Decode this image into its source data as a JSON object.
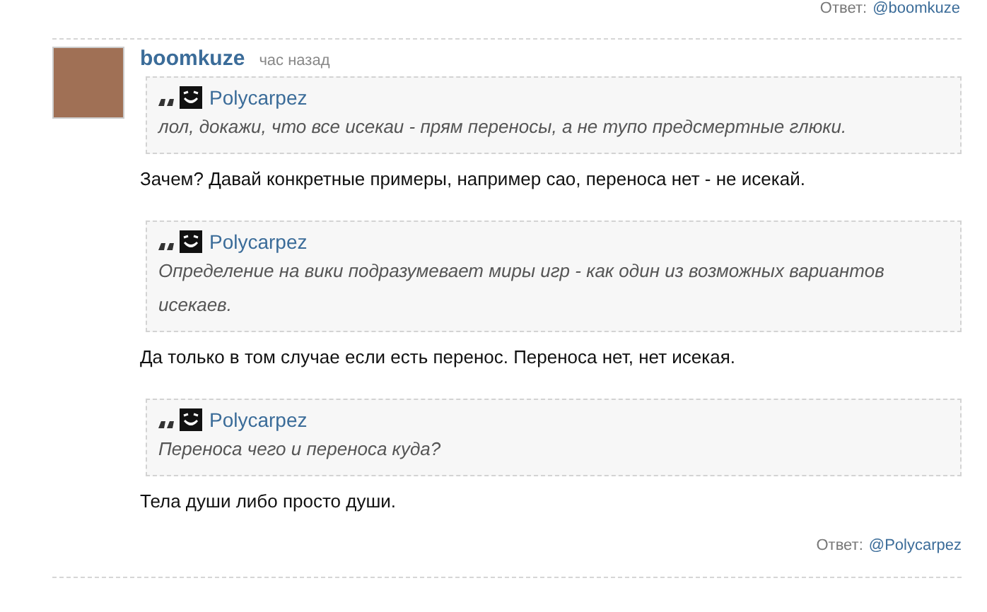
{
  "prev_reply": {
    "label": "Ответ:",
    "target": "@boomkuze"
  },
  "comment": {
    "author": "boomkuze",
    "time": "час назад",
    "blocks": [
      {
        "kind": "quote",
        "author": "Polycarpez",
        "text": "лол, докажи, что все исекаи - прям переносы, а не тупо предсмертные глюки."
      },
      {
        "kind": "text",
        "text": "Зачем? Давай конкретные примеры, например сао, переноса нет - не исекай."
      },
      {
        "kind": "quote",
        "author": "Polycarpez",
        "text": "Определение на вики подразумевает миры игр - как один из возможных вариантов исекаев."
      },
      {
        "kind": "text",
        "text": "Да только в том случае если есть перенос. Переноса нет, нет исекая."
      },
      {
        "kind": "quote",
        "author": "Polycarpez",
        "text": "Переноса чего и переноса куда?"
      },
      {
        "kind": "text",
        "text": "Тела души либо просто души."
      }
    ],
    "reply": {
      "label": "Ответ:",
      "target": "@Polycarpez"
    }
  }
}
